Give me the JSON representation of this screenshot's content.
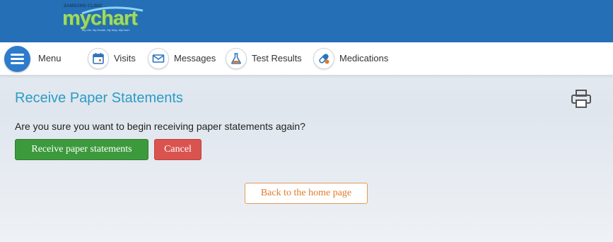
{
  "header": {
    "logo_clinic": "SAMSUNG CLINIC",
    "logo_text": "mychart",
    "logo_tagline": "My Life. My Health. My Way. MyChart."
  },
  "nav": {
    "menu_label": "Menu",
    "items": [
      {
        "label": "Visits",
        "icon": "calendar-icon"
      },
      {
        "label": "Messages",
        "icon": "envelope-icon"
      },
      {
        "label": "Test Results",
        "icon": "flask-icon"
      },
      {
        "label": "Medications",
        "icon": "pills-icon"
      }
    ]
  },
  "main": {
    "title": "Receive Paper Statements",
    "question": "Are you sure you want to begin receiving paper statements again?",
    "confirm_label": "Receive paper statements",
    "cancel_label": "Cancel",
    "home_label": "Back to the home page",
    "print_icon": "printer-icon"
  },
  "colors": {
    "header_bg": "#246fb6",
    "title": "#2b9cc4",
    "confirm_bg": "#3c9a3c",
    "cancel_bg": "#d9534f",
    "home_text": "#e07b2a"
  }
}
